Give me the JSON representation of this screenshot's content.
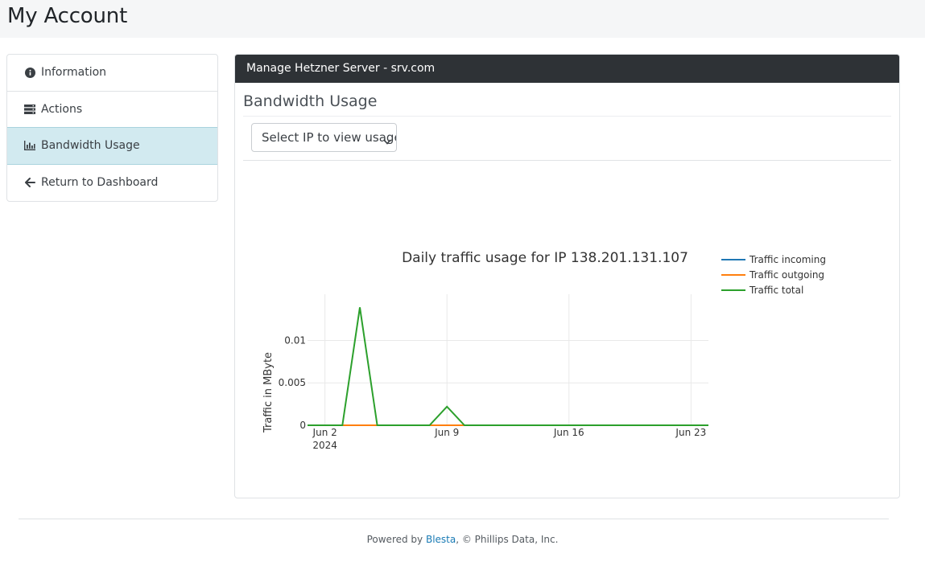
{
  "page": {
    "title": "My Account"
  },
  "sidebar": {
    "items": [
      {
        "label": "Information",
        "icon": "info-circle-icon",
        "active": false
      },
      {
        "label": "Actions",
        "icon": "server-icon",
        "active": false
      },
      {
        "label": "Bandwidth Usage",
        "icon": "bar-chart-icon",
        "active": true
      },
      {
        "label": "Return to Dashboard",
        "icon": "arrow-left-icon",
        "active": false
      }
    ]
  },
  "panel": {
    "header": "Manage Hetzner Server - srv.com",
    "subtitle": "Bandwidth Usage",
    "select": {
      "value": "Select IP to view usage"
    }
  },
  "chart_data": {
    "type": "line",
    "title": "Daily traffic usage for IP 138.201.131.107",
    "xlabel": "",
    "ylabel": "Traffic in MByte",
    "x_start": "2024-06-01",
    "x_ticks": [
      {
        "date": "2024-06-02",
        "label": "Jun 2",
        "sublabel": "2024"
      },
      {
        "date": "2024-06-09",
        "label": "Jun 9"
      },
      {
        "date": "2024-06-16",
        "label": "Jun 16"
      },
      {
        "date": "2024-06-23",
        "label": "Jun 23"
      }
    ],
    "y_ticks": [
      0,
      0.005,
      0.01
    ],
    "y_tick_labels": [
      "0",
      "0.005",
      "0.01"
    ],
    "xlim": [
      "2024-06-01",
      "2024-06-24"
    ],
    "ylim": [
      0,
      0.0145
    ],
    "grid": true,
    "legend_position": "right",
    "x": [
      "2024-06-01",
      "2024-06-02",
      "2024-06-03",
      "2024-06-04",
      "2024-06-05",
      "2024-06-06",
      "2024-06-07",
      "2024-06-08",
      "2024-06-09",
      "2024-06-10",
      "2024-06-11",
      "2024-06-12",
      "2024-06-13",
      "2024-06-14",
      "2024-06-15",
      "2024-06-16",
      "2024-06-17",
      "2024-06-18",
      "2024-06-19",
      "2024-06-20",
      "2024-06-21",
      "2024-06-22",
      "2024-06-23",
      "2024-06-24"
    ],
    "series": [
      {
        "name": "Traffic incoming",
        "color": "#1f77b4",
        "values": [
          0,
          0,
          0,
          0,
          0,
          0,
          0,
          0,
          0,
          0,
          0,
          0,
          0,
          0,
          0,
          0,
          0,
          0,
          0,
          0,
          0,
          0,
          0,
          0
        ]
      },
      {
        "name": "Traffic outgoing",
        "color": "#ff7f0e",
        "values": [
          0,
          0,
          0,
          0,
          0,
          0,
          0,
          0,
          0,
          0,
          0,
          0,
          0,
          0,
          0,
          0,
          0,
          0,
          0,
          0,
          0,
          0,
          0,
          0
        ]
      },
      {
        "name": "Traffic total",
        "color": "#2ca02c",
        "values": [
          0,
          0,
          0,
          0.0139,
          0,
          0,
          0,
          0,
          0.0022,
          0,
          0,
          0,
          0,
          0,
          0,
          0,
          0,
          0,
          0,
          0,
          0,
          0,
          0,
          0
        ]
      }
    ]
  },
  "footer": {
    "prefix": "Powered by ",
    "link": "Blesta",
    "suffix": ", © Phillips Data, Inc."
  }
}
